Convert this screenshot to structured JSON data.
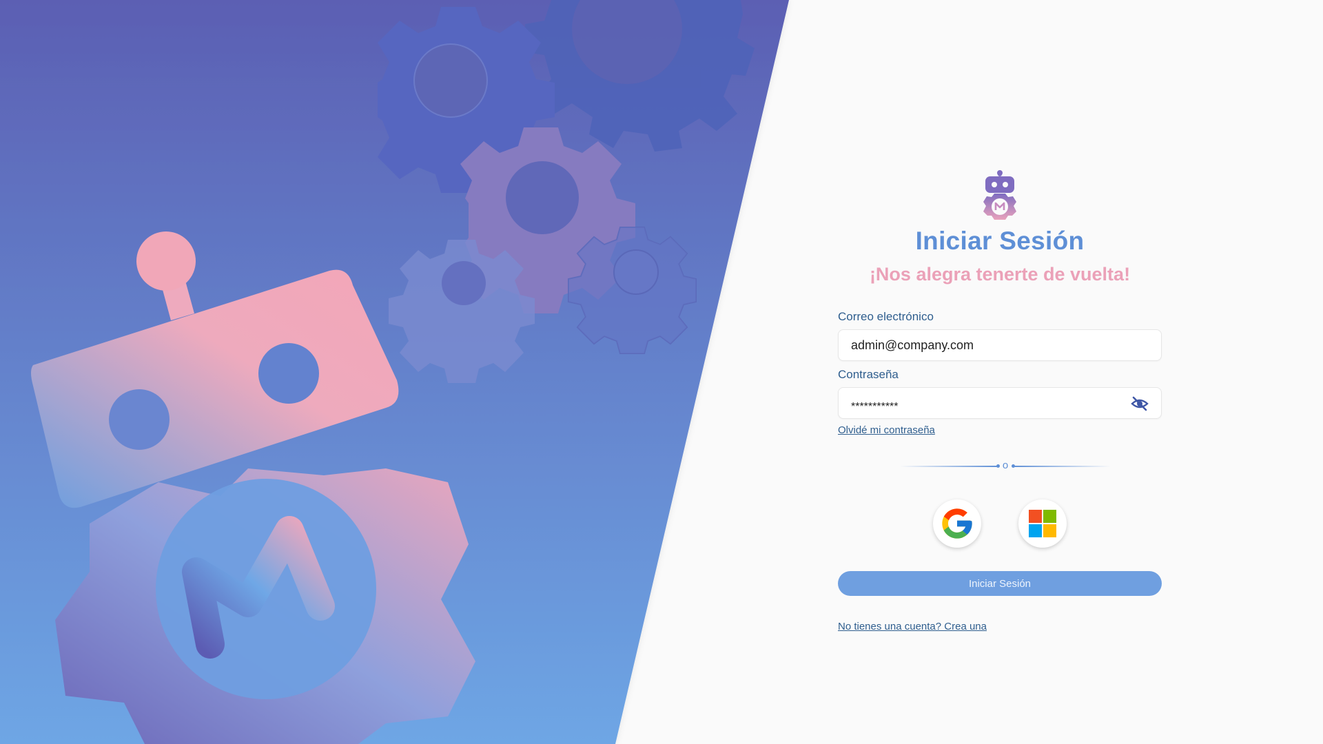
{
  "login": {
    "title": "Iniciar Sesión",
    "subtitle": "¡Nos alegra tenerte de vuelta!",
    "email_label": "Correo electrónico",
    "email_value": "admin@company.com",
    "password_label": "Contraseña",
    "password_value": "***********",
    "forgot_link": "Olvidé mi contraseña",
    "divider_text": "o",
    "submit_label": "Iniciar Sesión",
    "signup_link": "No tienes una cuenta? Crea una"
  },
  "social": {
    "google_icon": "google-icon",
    "microsoft_icon": "microsoft-icon"
  },
  "colors": {
    "title": "#5e8fd6",
    "subtitle": "#eba1b8",
    "label": "#2f5e8e",
    "button": "#6f9fe0",
    "hero_top": "#5b5fb3",
    "hero_bottom": "#6fa7e6"
  }
}
